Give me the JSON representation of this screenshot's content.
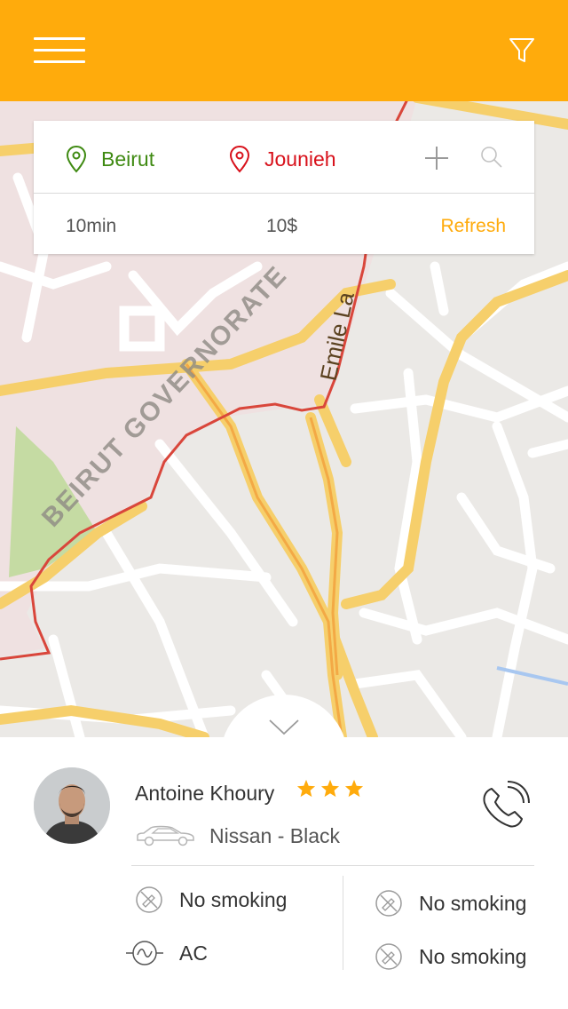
{
  "header": {
    "menu_icon": "hamburger-menu-icon",
    "filter_icon": "filter-icon",
    "background_color": "#ffab0c"
  },
  "map": {
    "labels": {
      "region": "BEIRUT GOVERNORATE",
      "road": "Emile La"
    }
  },
  "route": {
    "from": "Beirut",
    "to": "Jounieh",
    "from_color": "#3f8a12",
    "to_color": "#d8111b",
    "add_icon": "plus-icon",
    "search_icon": "search-icon",
    "duration": "10min",
    "price": "10$",
    "refresh_label": "Refresh"
  },
  "driver": {
    "name": "Antoine Khoury",
    "rating": 3,
    "car": "Nissan - Black",
    "call_icon": "phone-icon"
  },
  "features": {
    "left": [
      {
        "label": "No smoking",
        "icon": "no-smoking-icon"
      },
      {
        "label": "AC",
        "icon": "ac-icon"
      }
    ],
    "right": [
      {
        "label": "No smoking",
        "icon": "no-smoking-icon"
      },
      {
        "label": "No smoking",
        "icon": "no-smoking-icon"
      }
    ]
  }
}
